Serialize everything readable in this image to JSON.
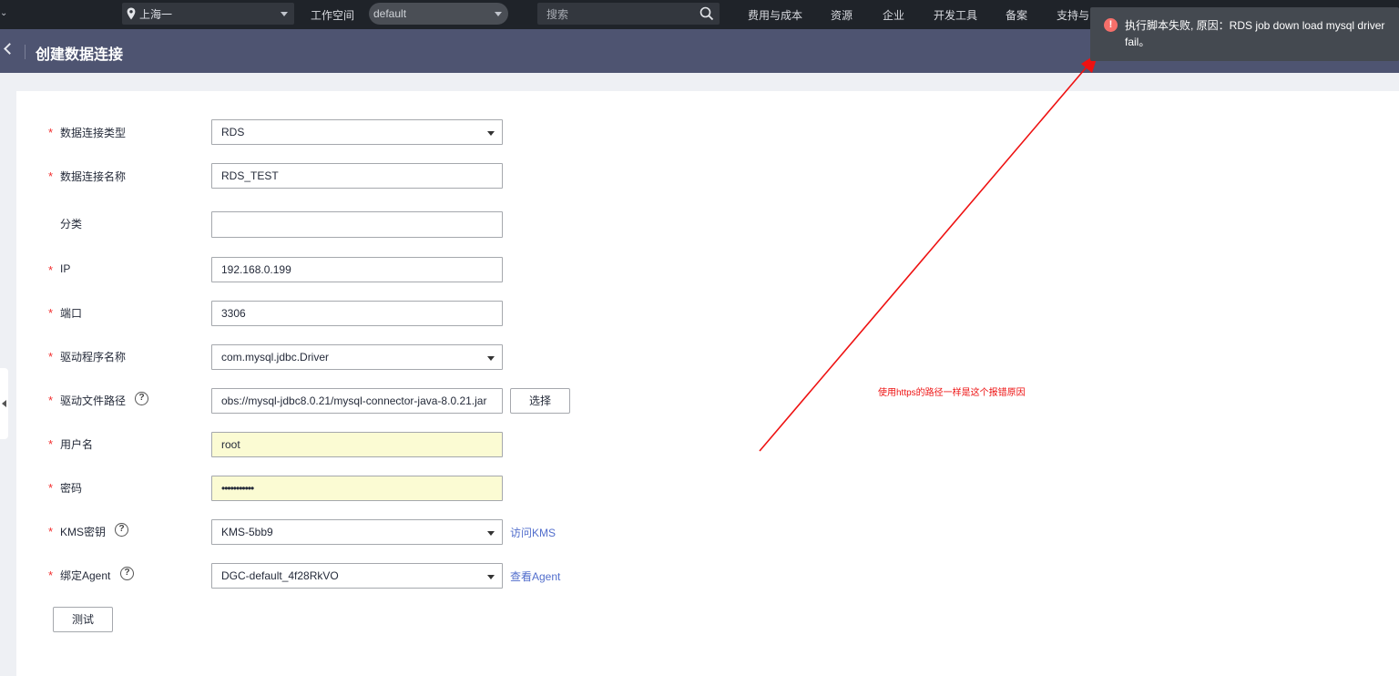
{
  "topbar": {
    "region": "上海一",
    "workspace_label": "工作空间",
    "workspace_value": "default",
    "search_placeholder": "搜索",
    "nav": [
      "费用与成本",
      "资源",
      "企业",
      "开发工具",
      "备案",
      "支持与"
    ]
  },
  "page": {
    "title": "创建数据连接"
  },
  "form": {
    "conn_type": {
      "label": "数据连接类型",
      "value": "RDS"
    },
    "conn_name": {
      "label": "数据连接名称",
      "value": "RDS_TEST"
    },
    "category": {
      "label": "分类",
      "value": ""
    },
    "ip": {
      "label": "IP",
      "value": "192.168.0.199"
    },
    "port": {
      "label": "端口",
      "value": "3306"
    },
    "driver_name": {
      "label": "驱动程序名称",
      "value": "com.mysql.jdbc.Driver"
    },
    "driver_path": {
      "label": "驱动文件路径",
      "value": "obs://mysql-jdbc8.0.21/mysql-connector-java-8.0.21.jar",
      "button": "选择"
    },
    "username": {
      "label": "用户名",
      "value": "root"
    },
    "password": {
      "label": "密码",
      "value": "•••••••••••"
    },
    "kms": {
      "label": "KMS密钥",
      "value": "KMS-5bb9",
      "link": "访问KMS"
    },
    "agent": {
      "label": "绑定Agent",
      "value": "DGC-default_4f28RkVO",
      "link": "查看Agent"
    },
    "test_button": "测试"
  },
  "toast": {
    "message": "执行脚本失败, 原因：RDS job down load mysql driver fail。"
  },
  "annotation": {
    "note": "使用https的路径一样是这个报错原因",
    "color": "#ee1111"
  },
  "colors": {
    "topbar": "#1f2329",
    "titlebar": "#4e5471",
    "required": "#f22e2e",
    "link": "#526ecc",
    "autofill": "#fbfbd3"
  }
}
